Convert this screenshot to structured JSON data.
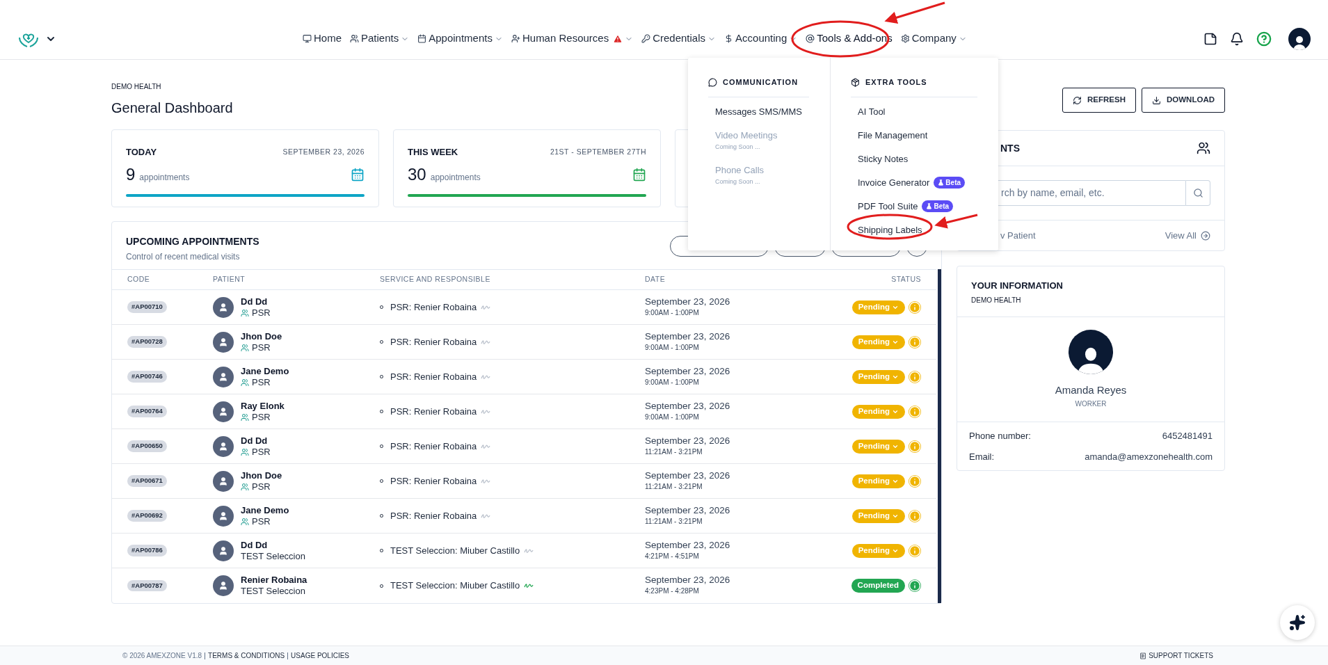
{
  "nav": {
    "items": [
      {
        "label": "Home",
        "caret": false,
        "warning": false,
        "expanded": false
      },
      {
        "label": "Patients",
        "caret": true,
        "warning": false,
        "expanded": false
      },
      {
        "label": "Appointments",
        "caret": true,
        "warning": false,
        "expanded": false
      },
      {
        "label": "Human Resources",
        "caret": true,
        "warning": true,
        "expanded": false
      },
      {
        "label": "Credentials",
        "caret": true,
        "warning": false,
        "expanded": false
      },
      {
        "label": "Accounting",
        "caret": true,
        "warning": false,
        "expanded": false
      },
      {
        "label": "Tools & Add-ons",
        "caret": false,
        "warning": false,
        "expanded": true
      },
      {
        "label": "Company",
        "caret": true,
        "warning": false,
        "expanded": false
      }
    ]
  },
  "dropdown": {
    "sections": [
      {
        "title": "COMMUNICATION",
        "items": [
          {
            "label": "Messages SMS/MMS",
            "disabled": false
          },
          {
            "label": "Video Meetings",
            "note": "Coming Soon ...",
            "disabled": true
          },
          {
            "label": "Phone Calls",
            "note": "Coming Soon ...",
            "disabled": true
          }
        ]
      },
      {
        "title": "EXTRA TOOLS",
        "items": [
          {
            "label": "AI Tool",
            "disabled": false
          },
          {
            "label": "File Management",
            "disabled": false
          },
          {
            "label": "Sticky Notes",
            "disabled": false
          },
          {
            "label": "Invoice Generator",
            "badge": "Beta",
            "disabled": false
          },
          {
            "label": "PDF Tool Suite",
            "badge": "Beta",
            "disabled": false
          },
          {
            "label": "Shipping Labels",
            "disabled": false
          }
        ]
      }
    ]
  },
  "page": {
    "organization": "DEMO HEALTH",
    "title": "General Dashboard",
    "buttons": [
      {
        "label": "REFRESH"
      },
      {
        "label": "DOWNLOAD"
      }
    ]
  },
  "stat_cards": [
    {
      "title": "TODAY",
      "date": "SEPTEMBER 23, 2026",
      "count": "9",
      "unit": "appointments",
      "color": "#0ea5c6"
    },
    {
      "title": "THIS WEEK",
      "date": "21ST - SEPTEMBER 27TH",
      "count": "30",
      "unit": "appointments",
      "color": "#22a652"
    }
  ],
  "appointments": {
    "title": "UPCOMING APPOINTMENTS",
    "subtitle": "Control of recent medical visits",
    "columns": [
      "CODE",
      "PATIENT",
      "SERVICE AND RESPONSIBLE",
      "DATE",
      "STATUS"
    ],
    "rows": [
      {
        "code": "#AP00710",
        "name": "Dd Dd",
        "group": "PSR",
        "group_icon": true,
        "service": "PSR: Renier Robaina",
        "date": "September 23, 2026",
        "time": "9:00AM - 1:00PM",
        "status": "Pending",
        "kind": "pending"
      },
      {
        "code": "#AP00728",
        "name": "Jhon Doe",
        "group": "PSR",
        "group_icon": true,
        "service": "PSR: Renier Robaina",
        "date": "September 23, 2026",
        "time": "9:00AM - 1:00PM",
        "status": "Pending",
        "kind": "pending"
      },
      {
        "code": "#AP00746",
        "name": "Jane Demo",
        "group": "PSR",
        "group_icon": true,
        "service": "PSR: Renier Robaina",
        "date": "September 23, 2026",
        "time": "9:00AM - 1:00PM",
        "status": "Pending",
        "kind": "pending"
      },
      {
        "code": "#AP00764",
        "name": "Ray Elonk",
        "group": "PSR",
        "group_icon": true,
        "service": "PSR: Renier Robaina",
        "date": "September 23, 2026",
        "time": "9:00AM - 1:00PM",
        "status": "Pending",
        "kind": "pending"
      },
      {
        "code": "#AP00650",
        "name": "Dd Dd",
        "group": "PSR",
        "group_icon": true,
        "service": "PSR: Renier Robaina",
        "date": "September 23, 2026",
        "time": "11:21AM - 3:21PM",
        "status": "Pending",
        "kind": "pending"
      },
      {
        "code": "#AP00671",
        "name": "Jhon Doe",
        "group": "PSR",
        "group_icon": true,
        "service": "PSR: Renier Robaina",
        "date": "September 23, 2026",
        "time": "11:21AM - 3:21PM",
        "status": "Pending",
        "kind": "pending"
      },
      {
        "code": "#AP00692",
        "name": "Jane Demo",
        "group": "PSR",
        "group_icon": true,
        "service": "PSR: Renier Robaina",
        "date": "September 23, 2026",
        "time": "11:21AM - 3:21PM",
        "status": "Pending",
        "kind": "pending"
      },
      {
        "code": "#AP00786",
        "name": "Dd Dd",
        "group": "TEST Seleccion",
        "group_icon": false,
        "service": "TEST Seleccion: Miuber Castillo",
        "date": "September 23, 2026",
        "time": "4:21PM - 4:51PM",
        "status": "Pending",
        "kind": "pending"
      },
      {
        "code": "#AP00787",
        "name": "Renier Robaina",
        "group": "TEST Seleccion",
        "group_icon": false,
        "service": "TEST Seleccion: Miuber Castillo",
        "date": "September 23, 2026",
        "time": "4:23PM - 4:28PM",
        "status": "Completed",
        "kind": "completed"
      }
    ]
  },
  "patients_panel": {
    "title": "NTS",
    "search_placeholder": "rch by name, email, etc.",
    "new_link": "v Patient",
    "view_all": "View All"
  },
  "info_panel": {
    "title": "YOUR INFORMATION",
    "organization": "DEMO HEALTH",
    "name": "Amanda Reyes",
    "role": "WORKER",
    "fields": [
      {
        "label": "Phone number:",
        "value": "6452481491"
      },
      {
        "label": "Email:",
        "value": "amanda@amexzonehealth.com"
      }
    ]
  },
  "footer": {
    "copyright": "© 2026 AMEXZONE V1.8",
    "links": [
      "TERMS & CONDITIONS",
      "USAGE POLICIES"
    ],
    "support": "SUPPORT TICKETS"
  }
}
